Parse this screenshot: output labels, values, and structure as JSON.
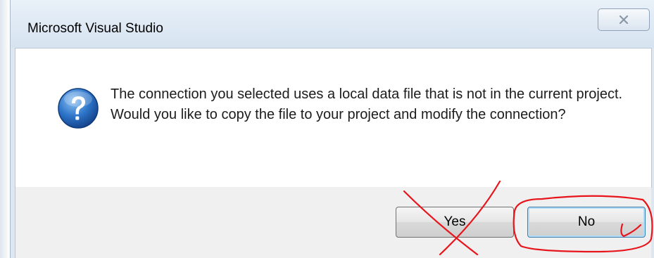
{
  "dialog": {
    "title": "Microsoft Visual Studio",
    "message": "The connection you selected uses a local data file that is not in the current project. Would you like to copy the file to your project and modify the connection?",
    "buttons": {
      "yes": "Yes",
      "no": "No"
    }
  },
  "icons": {
    "message_icon": "question-icon",
    "close": "close-icon"
  },
  "annotations": {
    "stroke_color": "#e8141b"
  }
}
